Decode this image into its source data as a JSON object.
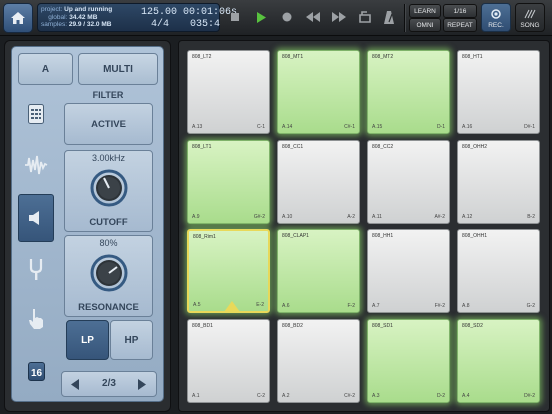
{
  "status": {
    "project_label": "project:",
    "project_name": "Up and running",
    "global_label": "global:",
    "global_value": "34.42 MB",
    "samples_label": "samples:",
    "samples_value": "29.9 / 32.0 MB",
    "bpm": "125.00",
    "time_sig": "4/4",
    "clock": "00:01:06s",
    "position": "035:4"
  },
  "toolbar": {
    "learn_label": "LEARN",
    "omni_label": "OMNI",
    "repeat_rate": "1/16",
    "repeat_label": "REPEAT",
    "rec_label": "REC.",
    "song_label": "SONG"
  },
  "left_panel": {
    "tab_a": "A",
    "tab_multi": "MULTI",
    "filter_title": "FILTER",
    "active_label": "ACTIVE",
    "cutoff_value": "3.00kHz",
    "cutoff_label": "CUTOFF",
    "resonance_value": "80%",
    "resonance_label": "RESONANCE",
    "lp_label": "LP",
    "hp_label": "HP",
    "page": "2/3",
    "step_badge": "16"
  },
  "pads": [
    {
      "name": "808_LT2",
      "num": "A.13",
      "note": "C-1",
      "active": false
    },
    {
      "name": "808_MT1",
      "num": "A.14",
      "note": "C#-1",
      "active": true
    },
    {
      "name": "808_MT2",
      "num": "A.15",
      "note": "D-1",
      "active": true
    },
    {
      "name": "808_HT1",
      "num": "A.16",
      "note": "D#-1",
      "active": false
    },
    {
      "name": "808_LT1",
      "num": "A.9",
      "note": "G#-2",
      "active": true
    },
    {
      "name": "808_CC1",
      "num": "A.10",
      "note": "A-2",
      "active": false
    },
    {
      "name": "808_CC2",
      "num": "A.11",
      "note": "A#-2",
      "active": false
    },
    {
      "name": "808_OHH2",
      "num": "A.12",
      "note": "B-2",
      "active": false
    },
    {
      "name": "808_Rim1",
      "num": "A.5",
      "note": "E-2",
      "active": true,
      "selected": true
    },
    {
      "name": "808_CLAP1",
      "num": "A.6",
      "note": "F-2",
      "active": true
    },
    {
      "name": "808_HH1",
      "num": "A.7",
      "note": "F#-2",
      "active": false
    },
    {
      "name": "808_OHH1",
      "num": "A.8",
      "note": "G-2",
      "active": false
    },
    {
      "name": "808_BD1",
      "num": "A.1",
      "note": "C-2",
      "active": false
    },
    {
      "name": "808_BD2",
      "num": "A.2",
      "note": "C#-2",
      "active": false
    },
    {
      "name": "808_SD1",
      "num": "A.3",
      "note": "D-2",
      "active": true
    },
    {
      "name": "808_SD2",
      "num": "A.4",
      "note": "D#-2",
      "active": true
    }
  ],
  "colors": {
    "accent_blue": "#4d6f95",
    "pad_on": "#a9dc8c",
    "pad_selected_border": "#e8d95a",
    "play_green": "#58c23f"
  }
}
